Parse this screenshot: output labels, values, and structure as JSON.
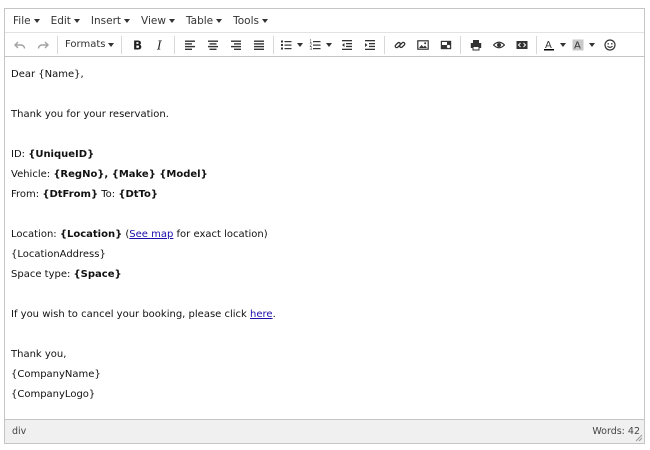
{
  "menubar": {
    "items": [
      {
        "label": "File"
      },
      {
        "label": "Edit"
      },
      {
        "label": "Insert"
      },
      {
        "label": "View"
      },
      {
        "label": "Table"
      },
      {
        "label": "Tools"
      }
    ]
  },
  "toolbar": {
    "formats_label": "Formats",
    "icons": [
      "undo-icon",
      "redo-icon",
      "bold-icon",
      "italic-icon",
      "align-left-icon",
      "align-center-icon",
      "align-right-icon",
      "align-justify-icon",
      "bullet-list-icon",
      "numbered-list-icon",
      "outdent-icon",
      "indent-icon",
      "link-icon",
      "image-icon",
      "media-icon",
      "print-icon",
      "preview-icon",
      "code-icon",
      "text-color-icon",
      "background-color-icon",
      "emoticons-icon"
    ],
    "text_color_letter": "A",
    "bg_color_letter": "A"
  },
  "content": {
    "greeting": "Dear {Name},",
    "thanks_line": "Thank you for your reservation.",
    "id_label": "ID: ",
    "id_value": "{UniqueID}",
    "vehicle_label": "Vehicle: ",
    "vehicle_value": "{RegNo}, {Make} {Model}",
    "from_label": "From: ",
    "from_value": "{DtFrom}",
    "to_label": " To: ",
    "to_value": "{DtTo}",
    "location_label": "Location: ",
    "location_value": "{Location}",
    "location_paren_open": " (",
    "see_map_link": "See map",
    "location_paren_close": " for exact location)",
    "location_address": "{LocationAddress}",
    "space_label": "Space type: ",
    "space_value": "{Space}",
    "cancel_text": "If you wish to cancel your booking, please click ",
    "cancel_link": "here",
    "cancel_end": ".",
    "closing": "Thank you,",
    "company_name": "{CompanyName}",
    "company_logo": "{CompanyLogo}"
  },
  "statusbar": {
    "path": "div",
    "word_count": "Words: 42"
  }
}
